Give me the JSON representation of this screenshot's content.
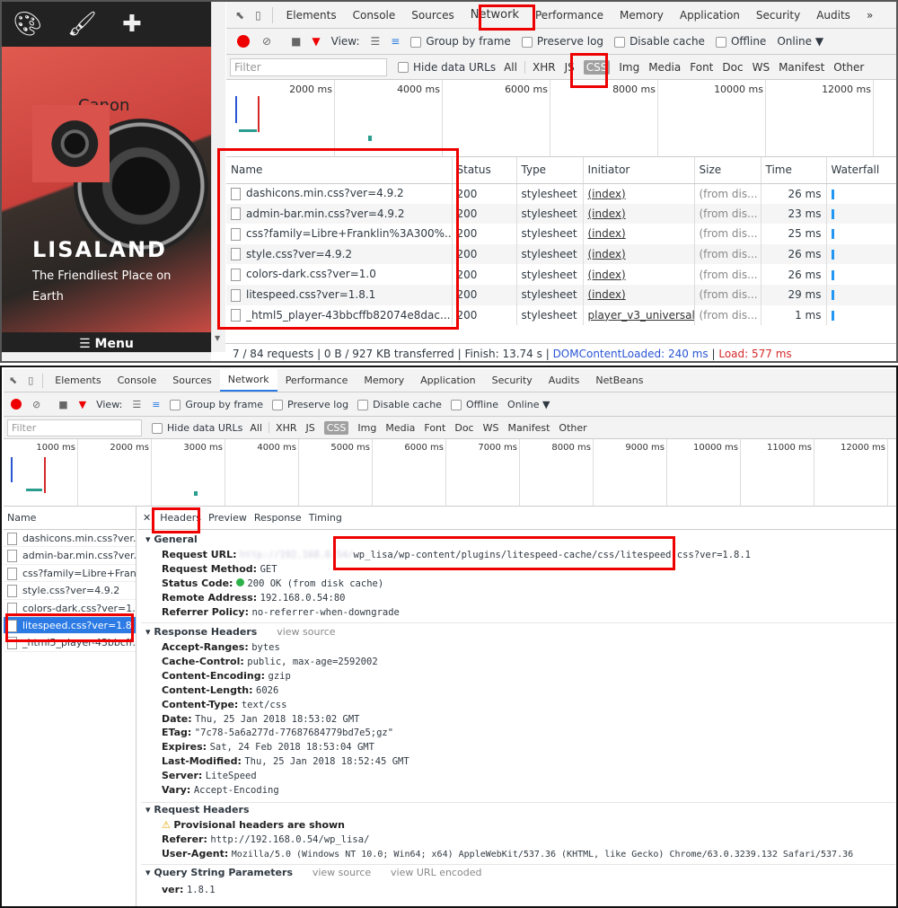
{
  "site": {
    "title": "LISALAND",
    "tagline": "The Friendliest Place on Earth",
    "menu": "☰ Menu",
    "icons": [
      "palette-icon",
      "brush-icon",
      "plus-icon"
    ]
  },
  "devtools_top": {
    "tabs": [
      "Elements",
      "Console",
      "Sources",
      "Network",
      "Performance",
      "Memory",
      "Application",
      "Security",
      "Audits"
    ],
    "active_tab": "Network",
    "toolbar": {
      "view": "View:",
      "group_by_frame": "Group by frame",
      "preserve_log": "Preserve log",
      "disable_cache": "Disable cache",
      "offline": "Offline",
      "throttle": "Online"
    },
    "filter_placeholder": "Filter",
    "hide_data_urls": "Hide data URLs",
    "types": [
      "All",
      "XHR",
      "JS",
      "CSS",
      "Img",
      "Media",
      "Font",
      "Doc",
      "WS",
      "Manifest",
      "Other"
    ],
    "active_type": "CSS",
    "timeline_ticks": [
      "2000 ms",
      "4000 ms",
      "6000 ms",
      "8000 ms",
      "10000 ms",
      "12000 ms"
    ],
    "columns": [
      "Name",
      "Status",
      "Type",
      "Initiator",
      "Size",
      "Time",
      "Waterfall"
    ],
    "rows": [
      {
        "name": "dashicons.min.css?ver=4.9.2",
        "status": "200",
        "type": "stylesheet",
        "initiator": "(index)",
        "size": "(from dis...",
        "time": "26 ms"
      },
      {
        "name": "admin-bar.min.css?ver=4.9.2",
        "status": "200",
        "type": "stylesheet",
        "initiator": "(index)",
        "size": "(from dis...",
        "time": "23 ms"
      },
      {
        "name": "css?family=Libre+Franklin%3A300%...",
        "status": "200",
        "type": "stylesheet",
        "initiator": "(index)",
        "size": "(from dis...",
        "time": "25 ms"
      },
      {
        "name": "style.css?ver=4.9.2",
        "status": "200",
        "type": "stylesheet",
        "initiator": "(index)",
        "size": "(from dis...",
        "time": "26 ms"
      },
      {
        "name": "colors-dark.css?ver=1.0",
        "status": "200",
        "type": "stylesheet",
        "initiator": "(index)",
        "size": "(from dis...",
        "time": "26 ms"
      },
      {
        "name": "litespeed.css?ver=1.8.1",
        "status": "200",
        "type": "stylesheet",
        "initiator": "(index)",
        "size": "(from dis...",
        "time": "29 ms"
      },
      {
        "name": "_html5_player-43bbcffb82074e8dac...",
        "status": "200",
        "type": "stylesheet",
        "initiator": "player_v3_universal",
        "size": "(from dis...",
        "time": "1 ms"
      }
    ],
    "status_bar": {
      "summary": "7 / 84 requests | 0 B / 927 KB transferred | Finish: 13.74 s |",
      "dcl": "DOMContentLoaded: 240 ms",
      "sep": "|",
      "load": "Load: 577 ms"
    }
  },
  "devtools_bottom": {
    "tabs": [
      "Elements",
      "Console",
      "Sources",
      "Network",
      "Performance",
      "Memory",
      "Application",
      "Security",
      "Audits",
      "NetBeans"
    ],
    "toolbar": {
      "view": "View:",
      "group_by_frame": "Group by frame",
      "preserve_log": "Preserve log",
      "disable_cache": "Disable cache",
      "offline": "Offline",
      "throttle": "Online"
    },
    "filter_placeholder": "Filter",
    "hide_data_urls": "Hide data URLs",
    "types": [
      "All",
      "XHR",
      "JS",
      "CSS",
      "Img",
      "Media",
      "Font",
      "Doc",
      "WS",
      "Manifest",
      "Other"
    ],
    "timeline_ticks": [
      "1000 ms",
      "2000 ms",
      "3000 ms",
      "4000 ms",
      "5000 ms",
      "6000 ms",
      "7000 ms",
      "8000 ms",
      "9000 ms",
      "10000 ms",
      "11000 ms",
      "12000 ms"
    ],
    "list_header": "Name",
    "list": [
      "dashicons.min.css?ver...",
      "admin-bar.min.css?ver...",
      "css?family=Libre+Fran...",
      "style.css?ver=4.9.2",
      "colors-dark.css?ver=1.0",
      "litespeed.css?ver=1.8.1",
      "_html5_player-43bbcff..."
    ],
    "detail_tabs": [
      "Headers",
      "Preview",
      "Response",
      "Timing"
    ],
    "general": {
      "title": "General",
      "request_url_label": "Request URL:",
      "request_url_host": "http://192.168.0.54/",
      "request_url_path": "wp_lisa/wp-content/plugins/litespeed-cache/css/litespeed.css",
      "request_url_query": "?ver=1.8.1",
      "method_label": "Request Method:",
      "method": "GET",
      "status_label": "Status Code:",
      "status": "200 OK (from disk cache)",
      "remote_label": "Remote Address:",
      "remote": "192.168.0.54:80",
      "referrer_label": "Referrer Policy:",
      "referrer": "no-referrer-when-downgrade"
    },
    "response_headers": {
      "title": "Response Headers",
      "view_source": "view source",
      "items": [
        [
          "Accept-Ranges:",
          "bytes"
        ],
        [
          "Cache-Control:",
          "public, max-age=2592002"
        ],
        [
          "Content-Encoding:",
          "gzip"
        ],
        [
          "Content-Length:",
          "6026"
        ],
        [
          "Content-Type:",
          "text/css"
        ],
        [
          "Date:",
          "Thu, 25 Jan 2018 18:53:02 GMT"
        ],
        [
          "ETag:",
          "\"7c78-5a6a277d-77687684779bd7e5;gz\""
        ],
        [
          "Expires:",
          "Sat, 24 Feb 2018 18:53:04 GMT"
        ],
        [
          "Last-Modified:",
          "Thu, 25 Jan 2018 18:52:45 GMT"
        ],
        [
          "Server:",
          "LiteSpeed"
        ],
        [
          "Vary:",
          "Accept-Encoding"
        ]
      ]
    },
    "request_headers": {
      "title": "Request Headers",
      "warning": "Provisional headers are shown",
      "referer_label": "Referer:",
      "referer": "http://192.168.0.54/wp_lisa/",
      "ua_label": "User-Agent:",
      "ua": "Mozilla/5.0 (Windows NT 10.0; Win64; x64) AppleWebKit/537.36 (KHTML, like Gecko) Chrome/63.0.3239.132 Safari/537.36"
    },
    "query": {
      "title": "Query String Parameters",
      "view_source": "view source",
      "view_url_encoded": "view URL encoded",
      "param_label": "ver:",
      "param_value": "1.8.1"
    }
  },
  "colors": {
    "highlight": "#e00000",
    "record": "#e00000",
    "selected": "#2c7be5",
    "dcl": "#2a55d4",
    "load": "#d62a2a"
  }
}
